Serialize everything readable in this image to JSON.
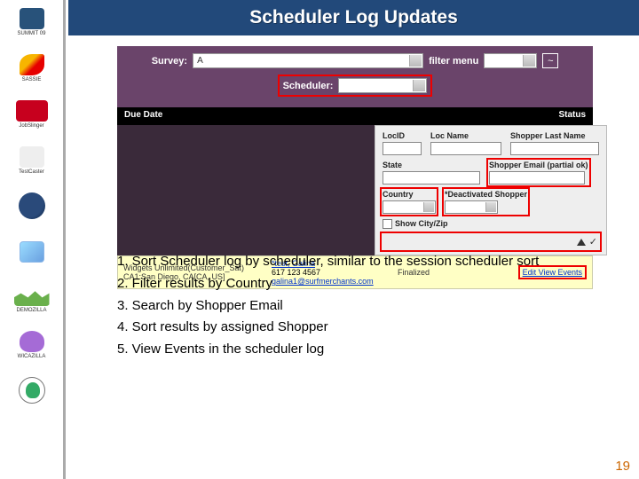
{
  "title": "Scheduler Log Updates",
  "sidebar": {
    "logos": [
      {
        "caption": "SUMMIT 09"
      },
      {
        "caption": "SASSIE"
      },
      {
        "caption": "JobSlinger"
      },
      {
        "caption": "TestCaster"
      },
      {
        "caption": ""
      },
      {
        "caption": ""
      },
      {
        "caption": "DEMOZILLA"
      },
      {
        "caption": "WICAZILLA"
      },
      {
        "caption": ""
      }
    ]
  },
  "survey_bar": {
    "survey_label": "Survey:",
    "survey_value": "A",
    "filter_menu_label": "filter menu",
    "apply_glyph": "~",
    "scheduler_label": "Scheduler:"
  },
  "headers": {
    "c1": "Due Date",
    "c2": "",
    "c3": "Status"
  },
  "filter": {
    "locid": "LocID",
    "locname": "Loc Name",
    "lastname": "Shopper Last Name",
    "state": "State",
    "email": "Shopper Email (partial ok)",
    "country": "Country",
    "deact": "*Deactivated Shopper",
    "showcityzip": "Show City/Zip",
    "sort_check": "✓",
    "tri": "▲"
  },
  "result": {
    "company": "Widgets Unlimited(Customer_Sat)",
    "location": "CA1:San Diego, CA[CA, US]",
    "name": "*test, Galina",
    "phone": "617 123 4567",
    "email": "galina1@surfmerchants.com",
    "status": "Finalized",
    "actions_prefix": "Edit View ",
    "actions_hi": "Events"
  },
  "bullets": {
    "b1": "1. Sort Scheduler log by scheduler, similar to the session scheduler sort",
    "b2": "2. Filter results by Country",
    "b3": "3. Search by Shopper Email",
    "b4": "4. Sort results by assigned Shopper",
    "b5": "5. View Events in the scheduler log"
  },
  "page_number": "19"
}
